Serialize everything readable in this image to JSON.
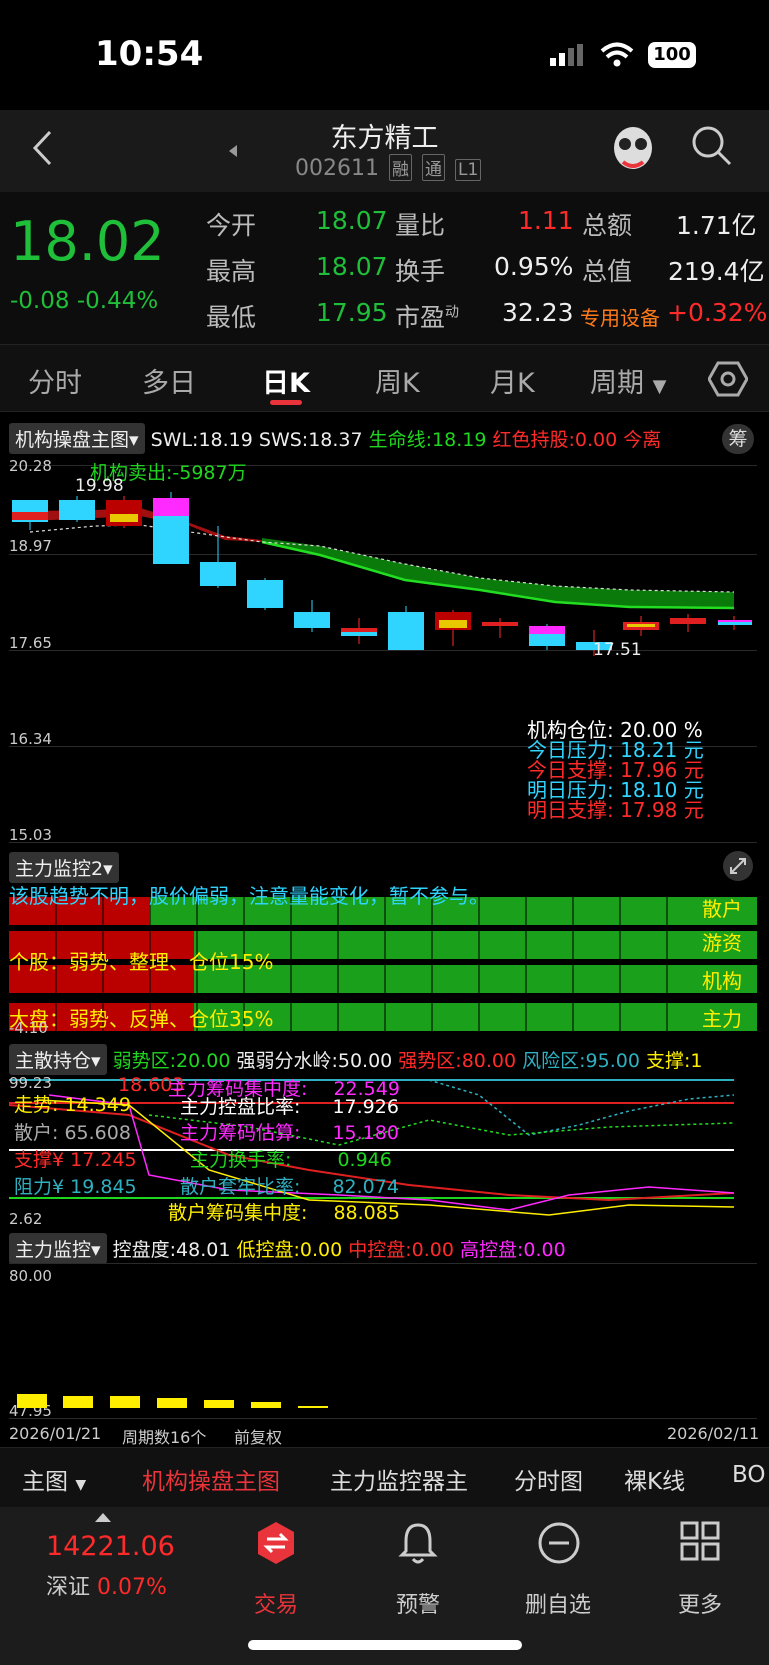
{
  "status_bar": {
    "time": "10:54",
    "battery": "100"
  },
  "header": {
    "stock_name": "东方精工",
    "stock_code": "002611",
    "tags": [
      "融",
      "通",
      "L1"
    ]
  },
  "quote": {
    "price": "18.02",
    "change": "-0.08",
    "change_pct": "-0.44%",
    "rows": [
      {
        "l1": "今开",
        "v1": "18.07",
        "l2": "量比",
        "v2": "1.11",
        "l3": "总额",
        "v3": "1.71亿"
      },
      {
        "l1": "最高",
        "v1": "18.07",
        "l2": "换手",
        "v2": "0.95%",
        "l3": "总值",
        "v3": "219.4亿"
      },
      {
        "l1": "最低",
        "v1": "17.95",
        "l2": "市盈",
        "l2sup": "动",
        "v2": "32.23",
        "l3": "专用设备",
        "v3": "+0.32%"
      }
    ]
  },
  "tabs": [
    "分时",
    "多日",
    "日K",
    "周K",
    "月K",
    "周期"
  ],
  "main_chart": {
    "indicator_name": "机构操盘主图",
    "swl": "SWL:18.19",
    "sws": "SWS:18.37",
    "life_line": "生命线:18.19",
    "red_hold": "红色持股:0.00",
    "today_tail": "今离",
    "chip_btn": "筹",
    "y_labels": [
      "20.28",
      "18.97",
      "17.65",
      "16.34",
      "15.03"
    ],
    "high_mark": "19.98",
    "low_mark": "17.51",
    "sell_note": "机构卖出:-5987万",
    "info": [
      {
        "label": "机构仓位:",
        "value": "20.00",
        "unit": "%",
        "color": "#ffffff"
      },
      {
        "label": "今日压力:",
        "value": "18.21",
        "unit": "元",
        "color": "#2fd4ff"
      },
      {
        "label": "今日支撑:",
        "value": "17.96",
        "unit": "元",
        "color": "#ff2a2a"
      },
      {
        "label": "明日压力:",
        "value": "18.10",
        "unit": "元",
        "color": "#2fd4ff"
      },
      {
        "label": "明日支撑:",
        "value": "17.98",
        "unit": "元",
        "color": "#ff2a2a"
      }
    ]
  },
  "monitor2": {
    "name": "主力监控2",
    "trend_text": "该股趋势不明，股价偏弱，注意量能变化，暂不参与。",
    "stock_text": "个股：弱势、整理、仓位15%",
    "market_text": "大盘：弱势、反弹、仓位35%",
    "y_bottom": "-4.10",
    "band_labels": [
      "散户",
      "游资",
      "机构",
      "主力"
    ]
  },
  "holdings": {
    "name": "主散持仓",
    "weak": "弱势区:20.00",
    "divide": "强弱分水岭:50.00",
    "strong": "强势区:80.00",
    "risk": "风险区:95.00",
    "support": "支撑:1",
    "y_top": "99.23",
    "y_bottom": "2.62",
    "left_items": [
      {
        "label": "走势:",
        "value": "14.349"
      },
      {
        "label": "散户:",
        "value": "65.608"
      },
      {
        "label": "支撑¥",
        "value": "17.245"
      },
      {
        "label": "阻力¥",
        "value": "19.845"
      }
    ],
    "price_hint": "18.603",
    "right_items": [
      {
        "label": "主力筹码集中度:",
        "value": "22.549"
      },
      {
        "label": "主力控盘比率:",
        "value": "17.926"
      },
      {
        "label": "主力筹码估算:",
        "value": "15.180"
      },
      {
        "label": "主力换手率:",
        "value": "0.946"
      },
      {
        "label": "散户套牢比率:",
        "value": "82.074"
      },
      {
        "label": "散户筹码集中度:",
        "value": "88.085"
      }
    ]
  },
  "monitor": {
    "name": "主力监控",
    "control": "控盘度:48.01",
    "low": "低控盘:0.00",
    "mid": "中控盘:0.00",
    "high": "高控盘:0.00",
    "y_top": "80.00",
    "y_bottom": "47.95",
    "bar_values": [
      48,
      48,
      48,
      48,
      48,
      48,
      48
    ]
  },
  "date_axis": {
    "start": "2026/01/21",
    "periods": "周期数16个",
    "adjust": "前复权",
    "end": "2026/02/11"
  },
  "indicator_bar": [
    "主图",
    "机构操盘主图",
    "主力监控器主",
    "分时图",
    "裸K线",
    "BO"
  ],
  "dock": {
    "index_value": "14221.06",
    "index_name": "深证",
    "index_pct": "0.07%",
    "items": [
      "交易",
      "预警",
      "删自选",
      "更多"
    ]
  },
  "colors": {
    "up": "#ff2a2a",
    "down": "#1fbf3a",
    "cyan": "#2fd4ff",
    "accent": "#e8343a"
  }
}
